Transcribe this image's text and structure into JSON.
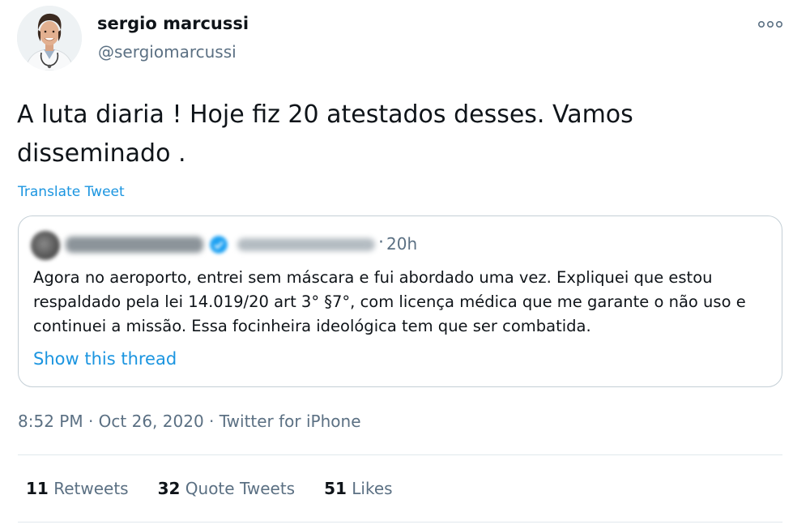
{
  "author": {
    "name": "sergio marcussi",
    "handle": "@sergiomarcussi"
  },
  "tweet": {
    "text": "A luta diaria ! Hoje fiz 20 atestados desses. Vamos disseminado .",
    "translate_label": "Translate Tweet"
  },
  "quote": {
    "time": "20h",
    "separator": "·",
    "text": "Agora no aeroporto, entrei sem máscara e fui abordado uma vez. Expliquei que estou respaldado pela lei 14.019/20 art 3° §7°, com licença médica que me garante o não uso e continuei a missão. Essa focinheira ideológica tem que ser combatida.",
    "thread_link": "Show this thread"
  },
  "meta": {
    "time": "8:52 PM",
    "date": "Oct 26, 2020",
    "source": "Twitter for iPhone",
    "separator": "·"
  },
  "stats": {
    "retweets_count": "11",
    "retweets_label": "Retweets",
    "quotes_count": "32",
    "quotes_label": "Quote Tweets",
    "likes_count": "51",
    "likes_label": "Likes"
  },
  "icons": {
    "more": "more-horizontal-icon",
    "verified": "verified-badge-icon"
  },
  "colors": {
    "link": "#1b95e0",
    "secondary_text": "#5b7083",
    "primary_text": "#0f1419",
    "border": "#c4cfd6",
    "divider": "#e1e8ed"
  }
}
